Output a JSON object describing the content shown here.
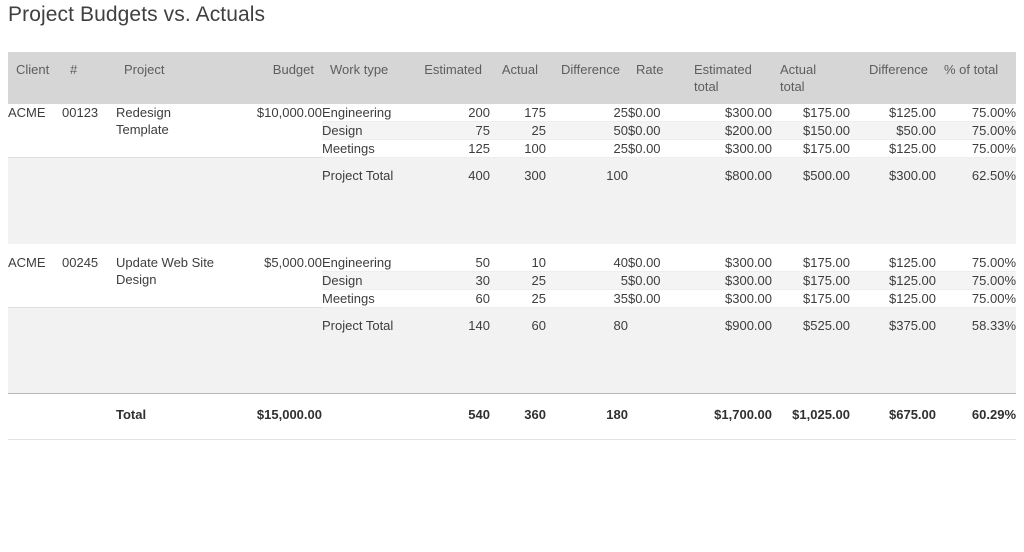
{
  "report": {
    "title": "Project Budgets vs. Actuals",
    "columns": [
      {
        "key": "client",
        "label": "Client",
        "align": "left"
      },
      {
        "key": "number",
        "label": "#",
        "align": "left"
      },
      {
        "key": "project",
        "label": "Project",
        "align": "left"
      },
      {
        "key": "budget",
        "label": "Budget",
        "align": "right"
      },
      {
        "key": "work_type",
        "label": "Work type",
        "align": "left"
      },
      {
        "key": "estimated",
        "label": "Estimated",
        "align": "right"
      },
      {
        "key": "actual",
        "label": "Actual",
        "align": "right"
      },
      {
        "key": "difference",
        "label": "Difference",
        "align": "right"
      },
      {
        "key": "rate",
        "label": "Rate",
        "align": "left"
      },
      {
        "key": "estimated_total",
        "label": "Estimated total",
        "align": "right"
      },
      {
        "key": "actual_total",
        "label": "Actual total",
        "align": "right"
      },
      {
        "key": "difference_total",
        "label": "Difference",
        "align": "right"
      },
      {
        "key": "percent_total",
        "label": "% of total",
        "align": "right"
      }
    ],
    "groups": [
      {
        "client": "ACME",
        "number": "00123",
        "project": "Redesign Template",
        "budget": "$10,000.00",
        "rows": [
          {
            "work_type": "Engineering",
            "estimated": "200",
            "actual": "175",
            "difference": "25",
            "rate": "$0.00",
            "estimated_total": "$300.00",
            "actual_total": "$175.00",
            "difference_total": "$125.00",
            "percent_total": "75.00%"
          },
          {
            "work_type": "Design",
            "estimated": "75",
            "actual": "25",
            "difference": "50",
            "rate": "$0.00",
            "estimated_total": "$200.00",
            "actual_total": "$150.00",
            "difference_total": "$50.00",
            "percent_total": "75.00%"
          },
          {
            "work_type": "Meetings",
            "estimated": "125",
            "actual": "100",
            "difference": "25",
            "rate": "$0.00",
            "estimated_total": "$300.00",
            "actual_total": "$175.00",
            "difference_total": "$125.00",
            "percent_total": "75.00%"
          }
        ],
        "subtotal": {
          "work_type": "Project Total",
          "estimated": "400",
          "actual": "300",
          "difference": "100",
          "rate": "",
          "estimated_total": "$800.00",
          "actual_total": "$500.00",
          "difference_total": "$300.00",
          "percent_total": "62.50%"
        }
      },
      {
        "client": "ACME",
        "number": "00245",
        "project": "Update Web Site Design",
        "budget": "$5,000.00",
        "rows": [
          {
            "work_type": "Engineering",
            "estimated": "50",
            "actual": "10",
            "difference": "40",
            "rate": "$0.00",
            "estimated_total": "$300.00",
            "actual_total": "$175.00",
            "difference_total": "$125.00",
            "percent_total": "75.00%"
          },
          {
            "work_type": "Design",
            "estimated": "30",
            "actual": "25",
            "difference": "5",
            "rate": "$0.00",
            "estimated_total": "$300.00",
            "actual_total": "$175.00",
            "difference_total": "$125.00",
            "percent_total": "75.00%"
          },
          {
            "work_type": "Meetings",
            "estimated": "60",
            "actual": "25",
            "difference": "35",
            "rate": "$0.00",
            "estimated_total": "$300.00",
            "actual_total": "$175.00",
            "difference_total": "$125.00",
            "percent_total": "75.00%"
          }
        ],
        "subtotal": {
          "work_type": "Project Total",
          "estimated": "140",
          "actual": "60",
          "difference": "80",
          "rate": "",
          "estimated_total": "$900.00",
          "actual_total": "$525.00",
          "difference_total": "$375.00",
          "percent_total": "58.33%"
        }
      }
    ],
    "grand_total": {
      "label": "Total",
      "budget": "$15,000.00",
      "estimated": "540",
      "actual": "360",
      "difference": "180",
      "rate": "",
      "estimated_total": "$1,700.00",
      "actual_total": "$1,025.00",
      "difference_total": "$675.00",
      "percent_total": "60.29%"
    }
  }
}
